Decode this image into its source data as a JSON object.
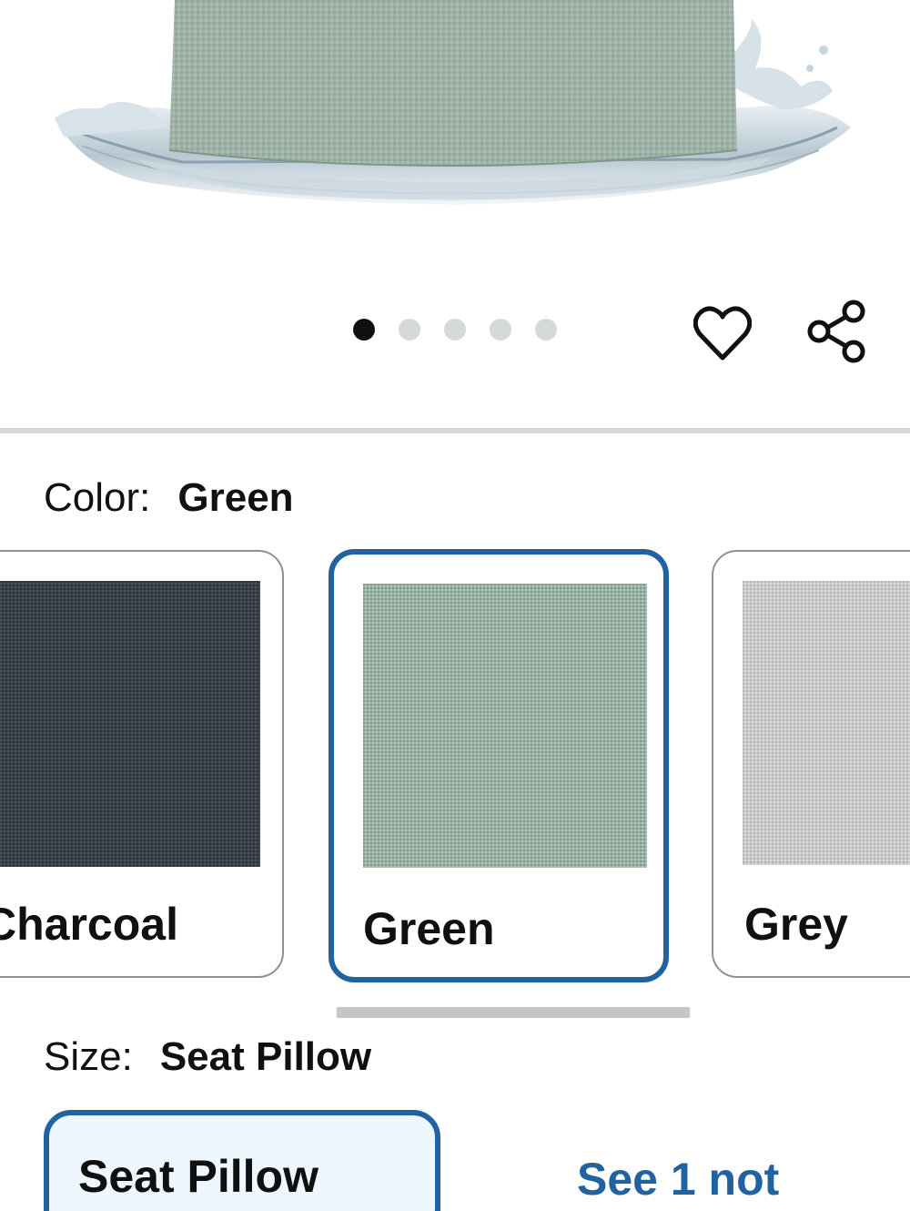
{
  "product_image": {
    "alt_icon": "pillow-water-splash-image"
  },
  "carousel": {
    "count": 5,
    "active_index": 0
  },
  "actions": {
    "wishlist_icon": "heart-icon",
    "share_icon": "share-icon"
  },
  "color_selector": {
    "label": "Color:",
    "selected": "Green",
    "options": [
      {
        "name": "Charcoal",
        "color": "#3a4047"
      },
      {
        "name": "Green",
        "color": "#9bb3a5"
      },
      {
        "name": "Grey",
        "color": "#c9c9c9"
      }
    ]
  },
  "size_selector": {
    "label": "Size:",
    "selected": "Seat Pillow",
    "option_label": "Seat Pillow",
    "see_more": "See 1 not"
  },
  "colors": {
    "accent": "#2162a1",
    "selected_bg": "#edf7fd",
    "divider": "#d5d9d9"
  }
}
